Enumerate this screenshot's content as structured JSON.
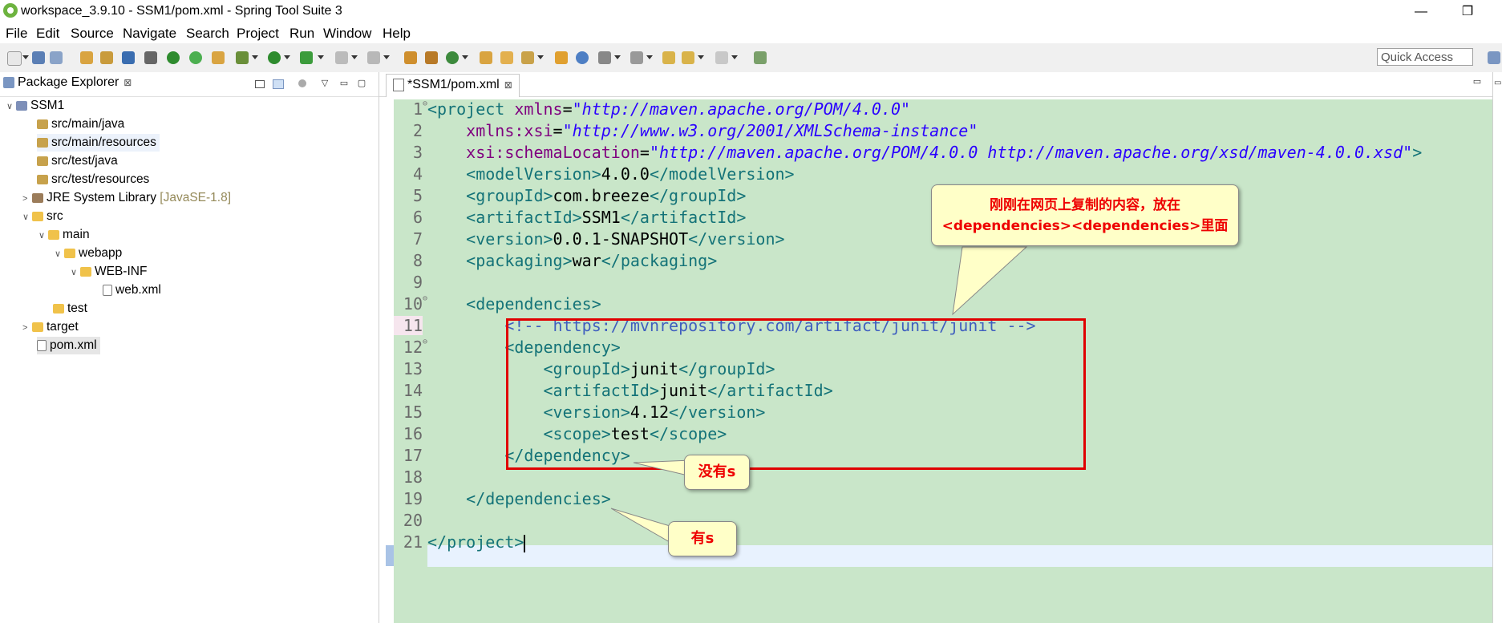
{
  "window": {
    "title": "workspace_3.9.10 - SSM1/pom.xml - Spring Tool Suite 3",
    "minimize": "—",
    "restore": "❐"
  },
  "menu": [
    "File",
    "Edit",
    "Source",
    "Navigate",
    "Search",
    "Project",
    "Run",
    "Window",
    "Help"
  ],
  "toolbar": {
    "quick_access_placeholder": "Quick Access"
  },
  "package_explorer": {
    "tab_label": "Package Explorer",
    "tab_close": "⊠",
    "tree": [
      {
        "label": "SSM1",
        "icon": "project-icon",
        "twisty": "∨"
      },
      {
        "label": "src/main/java",
        "icon": "source-folder-icon"
      },
      {
        "label": "src/main/resources",
        "icon": "source-folder-icon"
      },
      {
        "label": "src/test/java",
        "icon": "source-folder-icon"
      },
      {
        "label": "src/test/resources",
        "icon": "source-folder-icon"
      },
      {
        "label": "JRE System Library",
        "suffix": "[JavaSE-1.8]",
        "icon": "library-icon",
        "twisty": ">"
      },
      {
        "label": "src",
        "icon": "folder-icon",
        "twisty": "∨"
      },
      {
        "label": "main",
        "icon": "folder-icon",
        "twisty": "∨"
      },
      {
        "label": "webapp",
        "icon": "folder-icon",
        "twisty": "∨"
      },
      {
        "label": "WEB-INF",
        "icon": "folder-icon",
        "twisty": "∨"
      },
      {
        "label": "web.xml",
        "icon": "xml-file-icon"
      },
      {
        "label": "test",
        "icon": "folder-icon"
      },
      {
        "label": "target",
        "icon": "folder-icon",
        "twisty": ">"
      },
      {
        "label": "pom.xml",
        "icon": "maven-file-icon"
      }
    ]
  },
  "editor": {
    "tab_label": "*SSM1/pom.xml",
    "tab_close": "⊠",
    "line_numbers": [
      "1",
      "2",
      "3",
      "4",
      "5",
      "6",
      "7",
      "8",
      "9",
      "10",
      "11",
      "12",
      "13",
      "14",
      "15",
      "16",
      "17",
      "18",
      "19",
      "20",
      "21"
    ],
    "fold_markers": {
      "l1": "⊖",
      "l10": "⊖",
      "l12": "⊖"
    },
    "code": {
      "l1": {
        "open": "<project ",
        "attr": "xmlns",
        "eq": "=",
        "val": "\"http://maven.apache.org/POM/4.0.0\""
      },
      "l2": {
        "attr": "xmlns:xsi",
        "eq": "=",
        "val": "\"http://www.w3.org/2001/XMLSchema-instance\""
      },
      "l3": {
        "attr": "xsi:schemaLocation",
        "eq": "=",
        "val": "\"http://maven.apache.org/POM/4.0.0 http://maven.apache.org/xsd/maven-4.0.0.xsd\"",
        "close": ">"
      },
      "l4": {
        "open": "<modelVersion>",
        "text": "4.0.0",
        "close": "</modelVersion>"
      },
      "l5": {
        "open": "<groupId>",
        "text": "com.breeze",
        "close": "</groupId>"
      },
      "l6": {
        "open": "<artifactId>",
        "text": "SSM1",
        "close": "</artifactId>"
      },
      "l7": {
        "open": "<version>",
        "text": "0.0.1-SNAPSHOT",
        "close": "</version>"
      },
      "l8": {
        "open": "<packaging>",
        "text": "war",
        "close": "</packaging>"
      },
      "l10": {
        "open": "<dependencies>"
      },
      "l11": {
        "comment": "<!-- https://mvnrepository.com/artifact/junit/junit -->"
      },
      "l12": {
        "open": "<dependency>"
      },
      "l13": {
        "open": "<groupId>",
        "text": "junit",
        "close": "</groupId>"
      },
      "l14": {
        "open": "<artifactId>",
        "text": "junit",
        "close": "</artifactId>"
      },
      "l15": {
        "open": "<version>",
        "text": "4.12",
        "close": "</version>"
      },
      "l16": {
        "open": "<scope>",
        "text": "test",
        "close": "</scope>"
      },
      "l17": {
        "close": "</dependency>"
      },
      "l19": {
        "close": "</dependencies>"
      },
      "l21": {
        "close": "</project>"
      }
    }
  },
  "annotations": {
    "main_line1": "刚刚在网页上复制的内容，放在",
    "main_line2": "<dependencies><dependencies>里面",
    "no_s": "没有s",
    "has_s": "有s",
    "color": "#ee0000",
    "box_color": "#e00000"
  }
}
